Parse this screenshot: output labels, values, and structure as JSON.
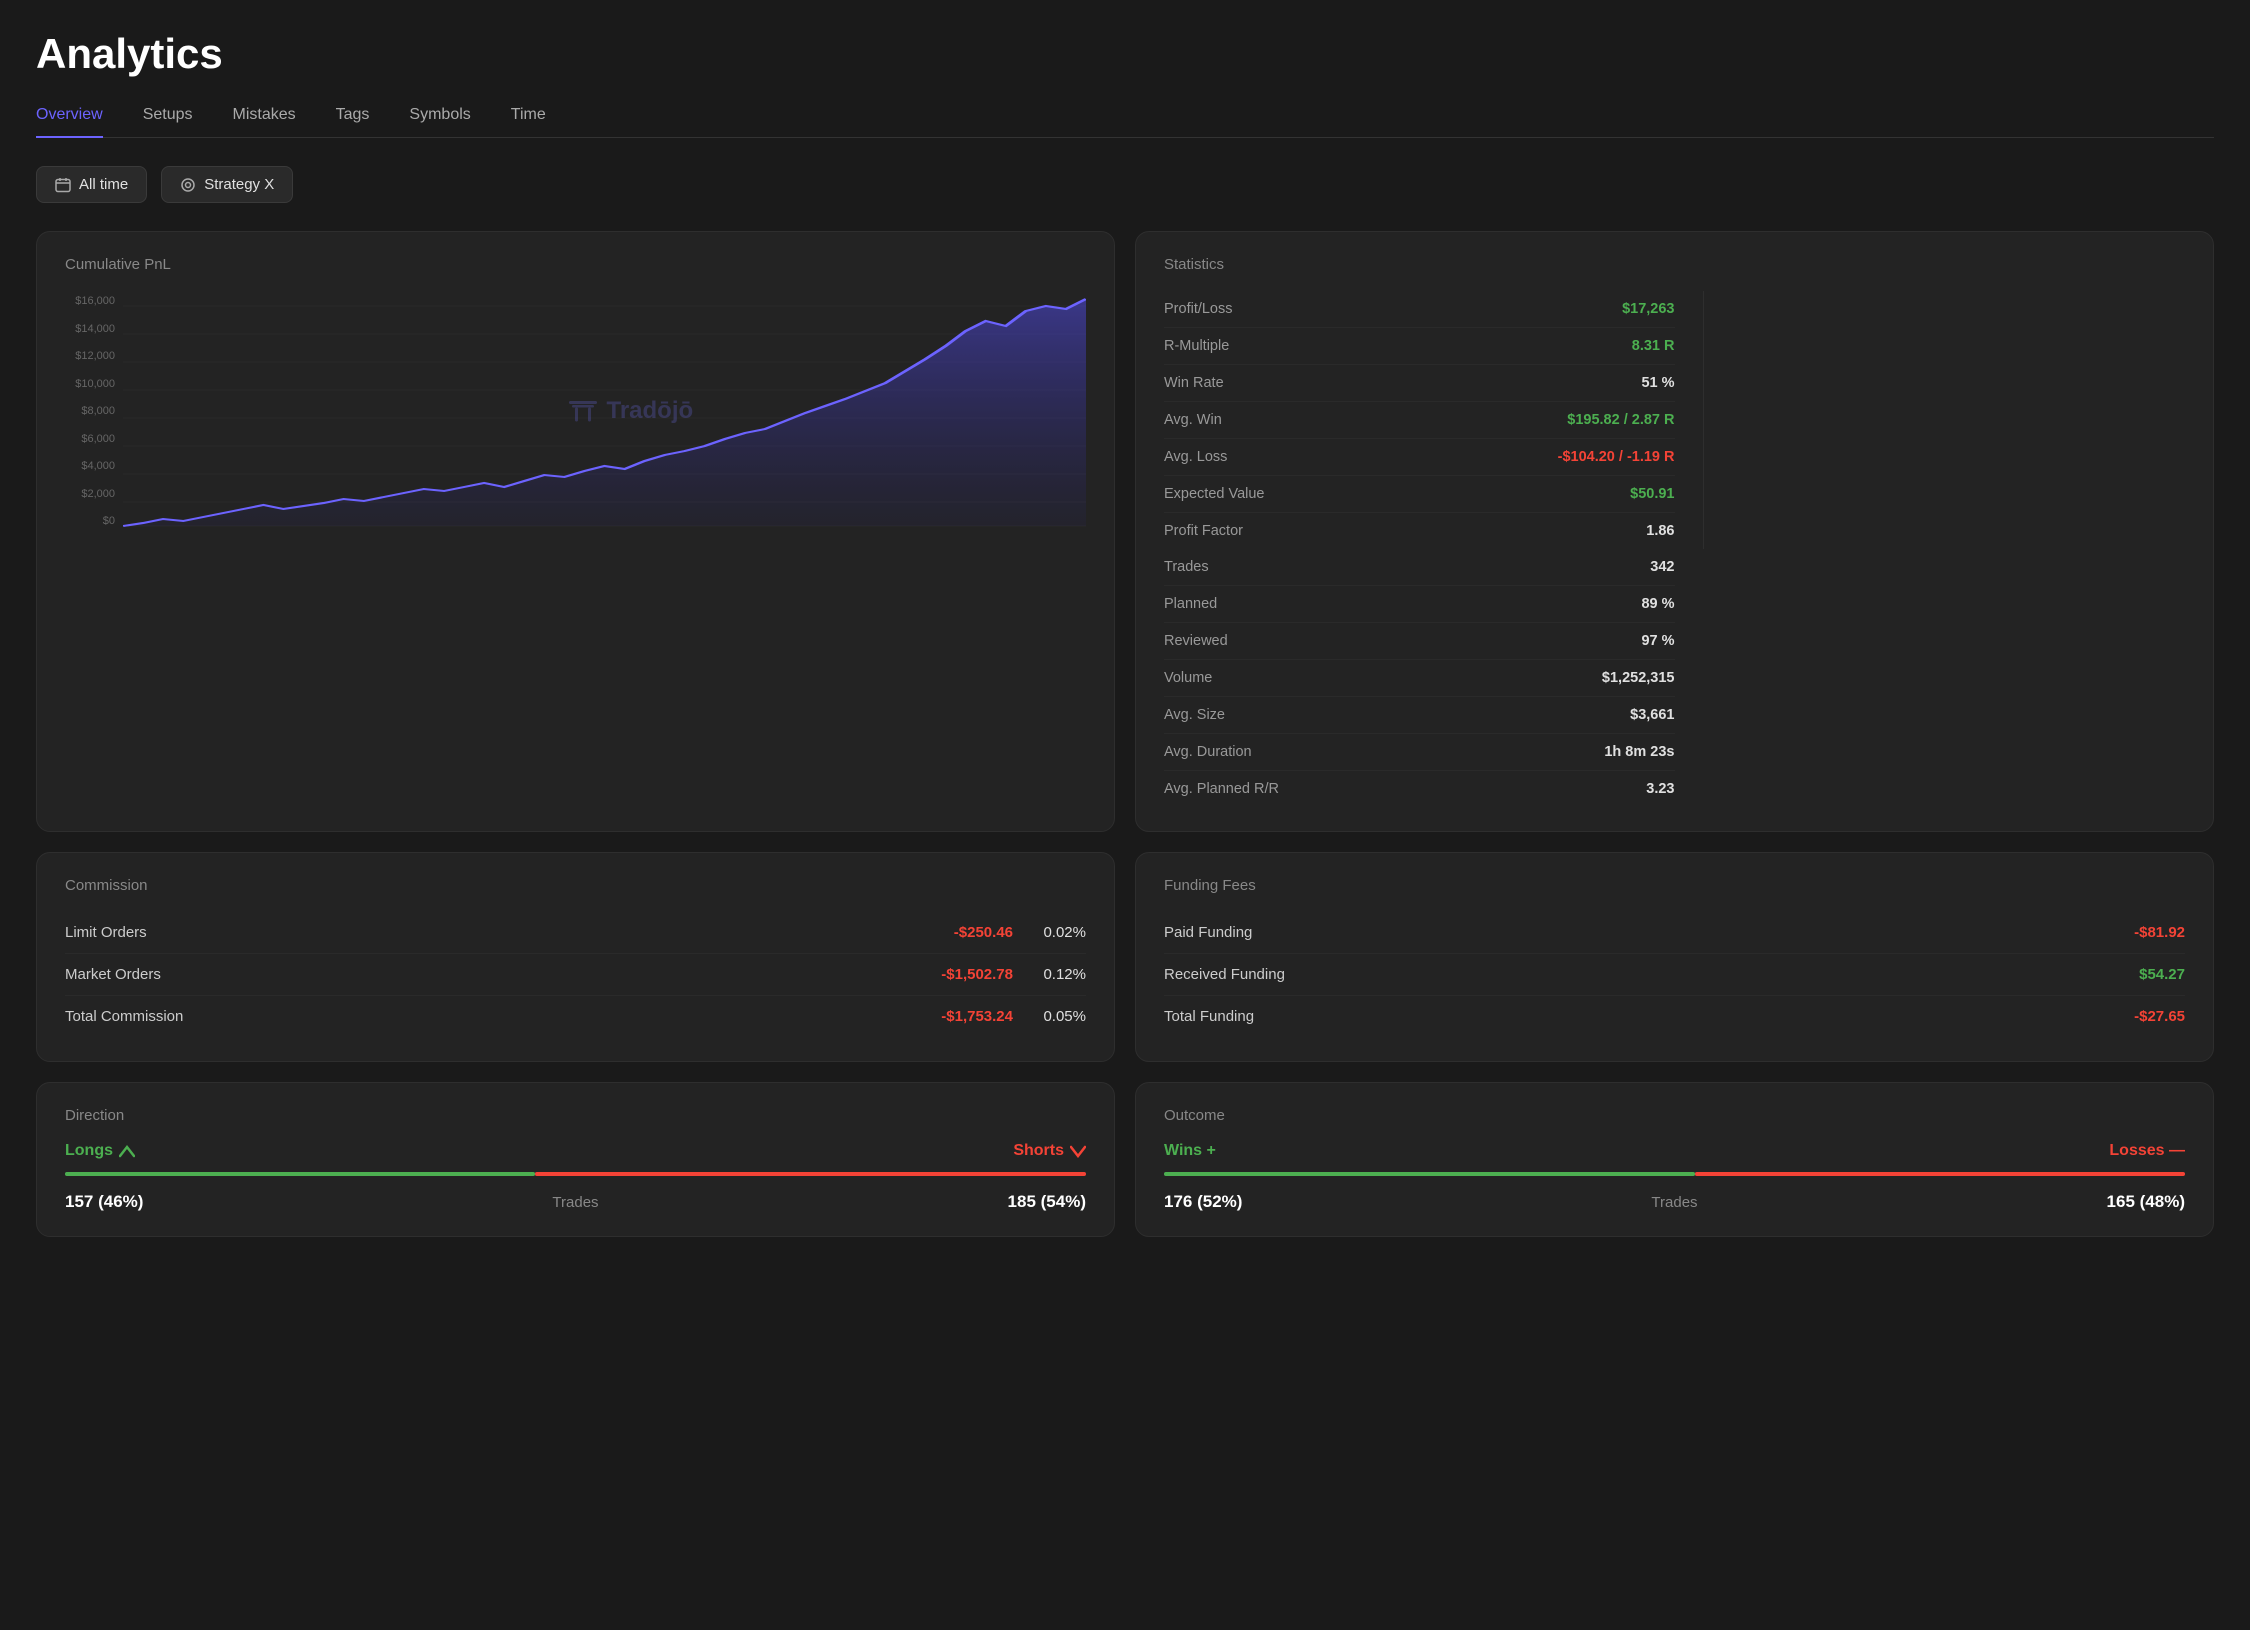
{
  "page": {
    "title": "Analytics"
  },
  "tabs": [
    {
      "id": "overview",
      "label": "Overview",
      "active": true
    },
    {
      "id": "setups",
      "label": "Setups",
      "active": false
    },
    {
      "id": "mistakes",
      "label": "Mistakes",
      "active": false
    },
    {
      "id": "tags",
      "label": "Tags",
      "active": false
    },
    {
      "id": "symbols",
      "label": "Symbols",
      "active": false
    },
    {
      "id": "time",
      "label": "Time",
      "active": false
    }
  ],
  "filters": {
    "time_label": "All time",
    "strategy_label": "Strategy X"
  },
  "cumulative_pnl": {
    "title": "Cumulative PnL",
    "watermark": "Tradōjō",
    "y_labels": [
      "$16,000",
      "$14,000",
      "$12,000",
      "$10,000",
      "$8,000",
      "$6,000",
      "$4,000",
      "$2,000",
      "$0"
    ]
  },
  "statistics": {
    "title": "Statistics",
    "left": [
      {
        "label": "Profit/Loss",
        "value": "$17,263",
        "color": "green"
      },
      {
        "label": "R-Multiple",
        "value": "8.31 R",
        "color": "green"
      },
      {
        "label": "Win Rate",
        "value": "51 %",
        "color": "neutral"
      },
      {
        "label": "Avg. Win",
        "value": "$195.82 / 2.87 R",
        "color": "green"
      },
      {
        "label": "Avg. Loss",
        "value": "-$104.20 / -1.19 R",
        "color": "red"
      },
      {
        "label": "Expected Value",
        "value": "$50.91",
        "color": "green"
      },
      {
        "label": "Profit Factor",
        "value": "1.86",
        "color": "neutral"
      }
    ],
    "right": [
      {
        "label": "Trades",
        "value": "342",
        "color": "neutral"
      },
      {
        "label": "Planned",
        "value": "89 %",
        "color": "neutral"
      },
      {
        "label": "Reviewed",
        "value": "97 %",
        "color": "neutral"
      },
      {
        "label": "Volume",
        "value": "$1,252,315",
        "color": "neutral"
      },
      {
        "label": "Avg. Size",
        "value": "$3,661",
        "color": "neutral"
      },
      {
        "label": "Avg. Duration",
        "value": "1h 8m 23s",
        "color": "neutral"
      },
      {
        "label": "Avg. Planned R/R",
        "value": "3.23",
        "color": "neutral"
      }
    ]
  },
  "commission": {
    "title": "Commission",
    "rows": [
      {
        "label": "Limit Orders",
        "amount": "-$250.46",
        "pct": "0.02%"
      },
      {
        "label": "Market Orders",
        "amount": "-$1,502.78",
        "pct": "0.12%"
      },
      {
        "label": "Total Commission",
        "amount": "-$1,753.24",
        "pct": "0.05%"
      }
    ]
  },
  "funding_fees": {
    "title": "Funding Fees",
    "rows": [
      {
        "label": "Paid Funding",
        "amount": "-$81.92",
        "color": "red"
      },
      {
        "label": "Received Funding",
        "amount": "$54.27",
        "color": "green"
      },
      {
        "label": "Total Funding",
        "amount": "-$27.65",
        "color": "red"
      }
    ]
  },
  "direction": {
    "title": "Direction",
    "longs_label": "Longs",
    "shorts_label": "Shorts",
    "longs_value": "157 (46%)",
    "shorts_value": "185 (54%)",
    "trades_label": "Trades",
    "longs_pct": 46,
    "shorts_pct": 54
  },
  "outcome": {
    "title": "Outcome",
    "wins_label": "Wins +",
    "losses_label": "Losses —",
    "wins_value": "176 (52%)",
    "losses_value": "165 (48%)",
    "trades_label": "Trades",
    "wins_pct": 52,
    "losses_pct": 48
  }
}
